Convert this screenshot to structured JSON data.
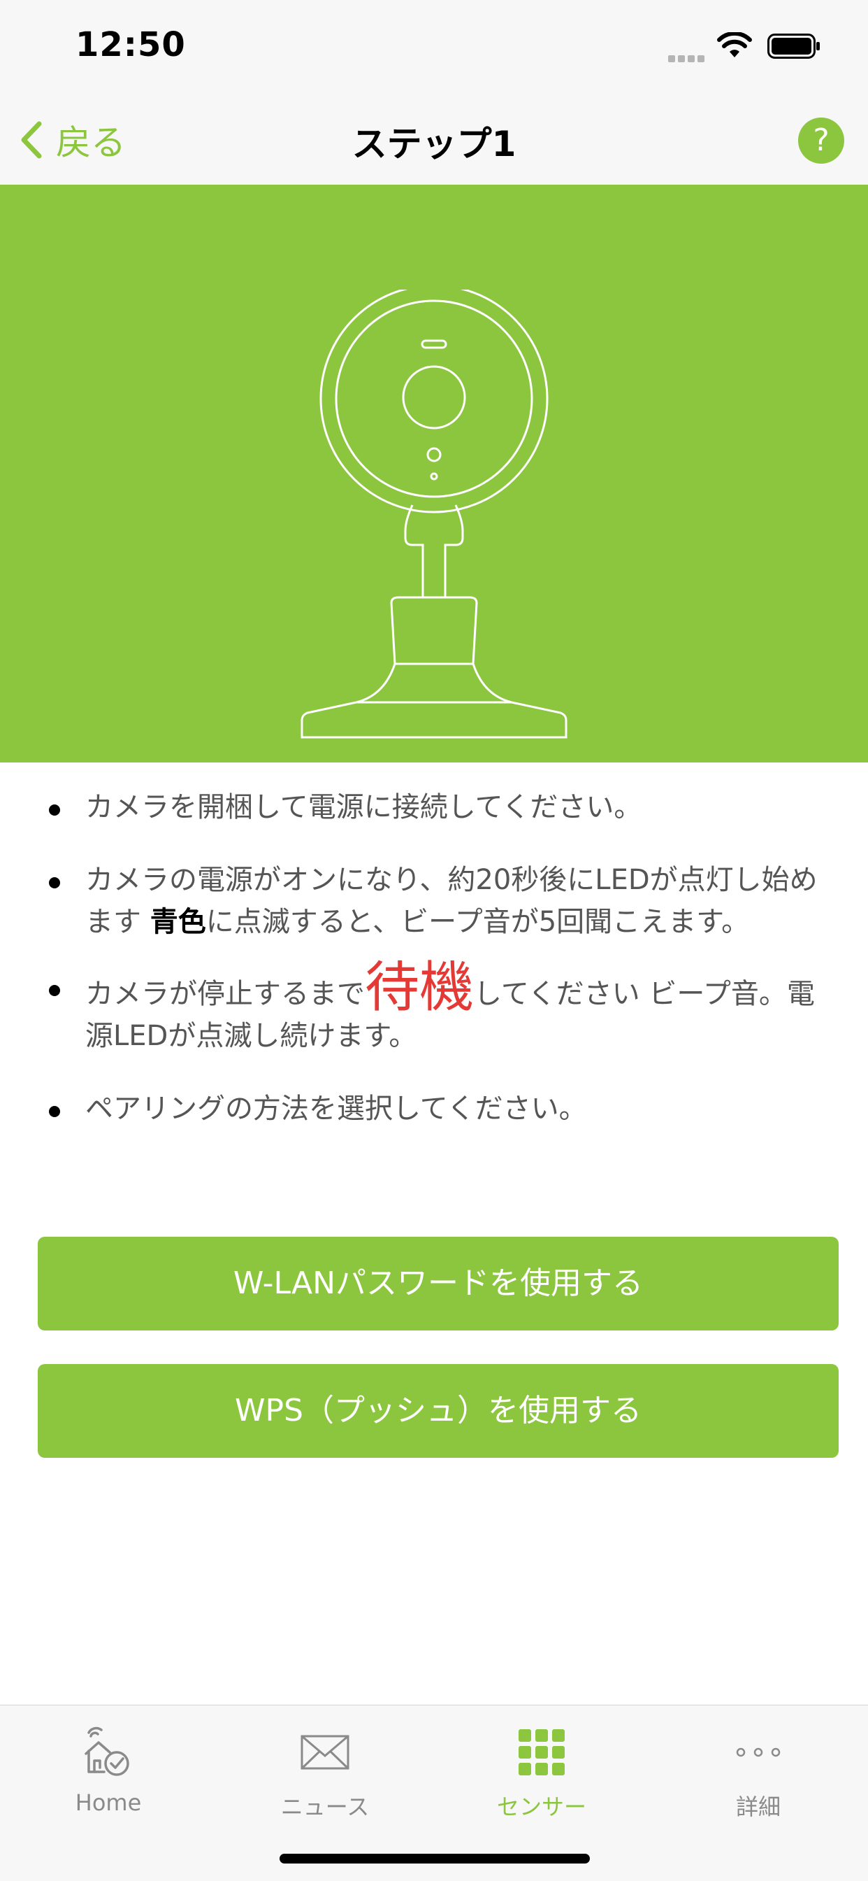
{
  "status_bar": {
    "time": "12:50"
  },
  "nav": {
    "back_label": "戻る",
    "title": "ステップ1",
    "help_label": "?"
  },
  "instructions": {
    "item1": "カメラを開梱して電源に接続してください。",
    "item2_part1": "カメラの電源がオンになり、約20秒後にLEDが点灯し始めます ",
    "item2_emphasis": "青色",
    "item2_part2": "に点滅すると、ビープ音が5回聞こえます。",
    "item3_part1": "カメラが停止するまで",
    "item3_emphasis": "待機",
    "item3_part2": "してください ビープ音。電源LEDが点滅し続けます。",
    "item4": "ペアリングの方法を選択してください。"
  },
  "buttons": {
    "wlan": "W-LANパスワードを使用する",
    "wps": "WPS（プッシュ）を使用する"
  },
  "tabs": [
    {
      "label": "Home",
      "icon": "home-check-icon"
    },
    {
      "label": "ニュース",
      "icon": "envelope-icon"
    },
    {
      "label": "センサー",
      "icon": "grid-icon",
      "active": true
    },
    {
      "label": "詳細",
      "icon": "more-dots-icon"
    }
  ],
  "colors": {
    "accent": "#8cc63f",
    "emphasis_red": "#e53935"
  }
}
